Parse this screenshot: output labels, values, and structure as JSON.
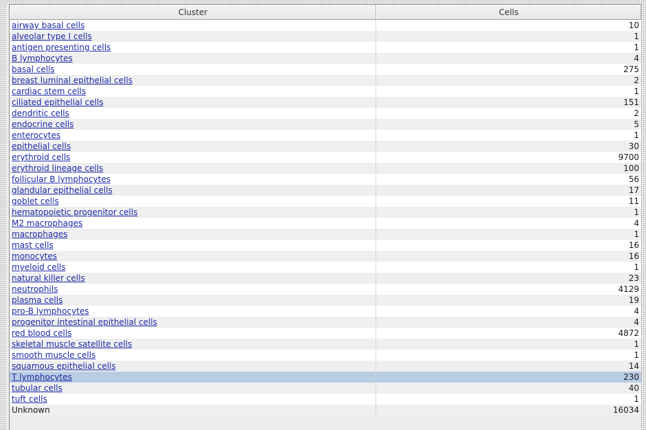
{
  "table": {
    "headers": {
      "cluster": "Cluster",
      "cells": "Cells"
    },
    "rows": [
      {
        "cluster": "airway basal cells",
        "cells": "10",
        "link": true
      },
      {
        "cluster": "alveolar type I cells",
        "cells": "1",
        "link": true
      },
      {
        "cluster": "antigen presenting cells",
        "cells": "1",
        "link": true
      },
      {
        "cluster": "B lymphocytes",
        "cells": "4",
        "link": true
      },
      {
        "cluster": "basal cells",
        "cells": "275",
        "link": true
      },
      {
        "cluster": "breast luminal epithelial cells",
        "cells": "2",
        "link": true
      },
      {
        "cluster": "cardiac stem cells",
        "cells": "1",
        "link": true
      },
      {
        "cluster": "ciliated epithelial cells",
        "cells": "151",
        "link": true
      },
      {
        "cluster": "dendritic cells",
        "cells": "2",
        "link": true
      },
      {
        "cluster": "endocrine cells",
        "cells": "5",
        "link": true
      },
      {
        "cluster": "enterocytes",
        "cells": "1",
        "link": true
      },
      {
        "cluster": "epithelial cells",
        "cells": "30",
        "link": true
      },
      {
        "cluster": "erythroid cells",
        "cells": "9700",
        "link": true
      },
      {
        "cluster": "erythroid lineage cells",
        "cells": "100",
        "link": true
      },
      {
        "cluster": "follicular B lymphocytes",
        "cells": "56",
        "link": true
      },
      {
        "cluster": "glandular epithelial cells",
        "cells": "17",
        "link": true
      },
      {
        "cluster": "goblet cells",
        "cells": "11",
        "link": true
      },
      {
        "cluster": "hematopoietic progenitor cells",
        "cells": "1",
        "link": true
      },
      {
        "cluster": "M2 macrophages",
        "cells": "4",
        "link": true
      },
      {
        "cluster": "macrophages",
        "cells": "1",
        "link": true
      },
      {
        "cluster": "mast cells",
        "cells": "16",
        "link": true
      },
      {
        "cluster": "monocytes",
        "cells": "16",
        "link": true
      },
      {
        "cluster": "myeloid cells",
        "cells": "1",
        "link": true
      },
      {
        "cluster": "natural killer cells",
        "cells": "23",
        "link": true
      },
      {
        "cluster": "neutrophils",
        "cells": "4129",
        "link": true
      },
      {
        "cluster": "plasma cells",
        "cells": "19",
        "link": true
      },
      {
        "cluster": "pro-B lymphocytes",
        "cells": "4",
        "link": true
      },
      {
        "cluster": "progenitor intestinal epithelial cells",
        "cells": "4",
        "link": true
      },
      {
        "cluster": "red blood cells",
        "cells": "4872",
        "link": true
      },
      {
        "cluster": "skeletal muscle satellite cells",
        "cells": "1",
        "link": true
      },
      {
        "cluster": "smooth muscle cells",
        "cells": "1",
        "link": true
      },
      {
        "cluster": "squamous epithelial cells",
        "cells": "14",
        "link": true
      },
      {
        "cluster": "T lymphocytes",
        "cells": "230",
        "link": true,
        "selected": true
      },
      {
        "cluster": "tubular cells",
        "cells": "40",
        "link": true
      },
      {
        "cluster": "tuft cells",
        "cells": "1",
        "link": true
      },
      {
        "cluster": "Unknown",
        "cells": "16034",
        "link": false
      }
    ]
  },
  "colors": {
    "link": "#1b2aa6",
    "selected_row": "#b8cce4",
    "alt_row": "#efefef"
  }
}
